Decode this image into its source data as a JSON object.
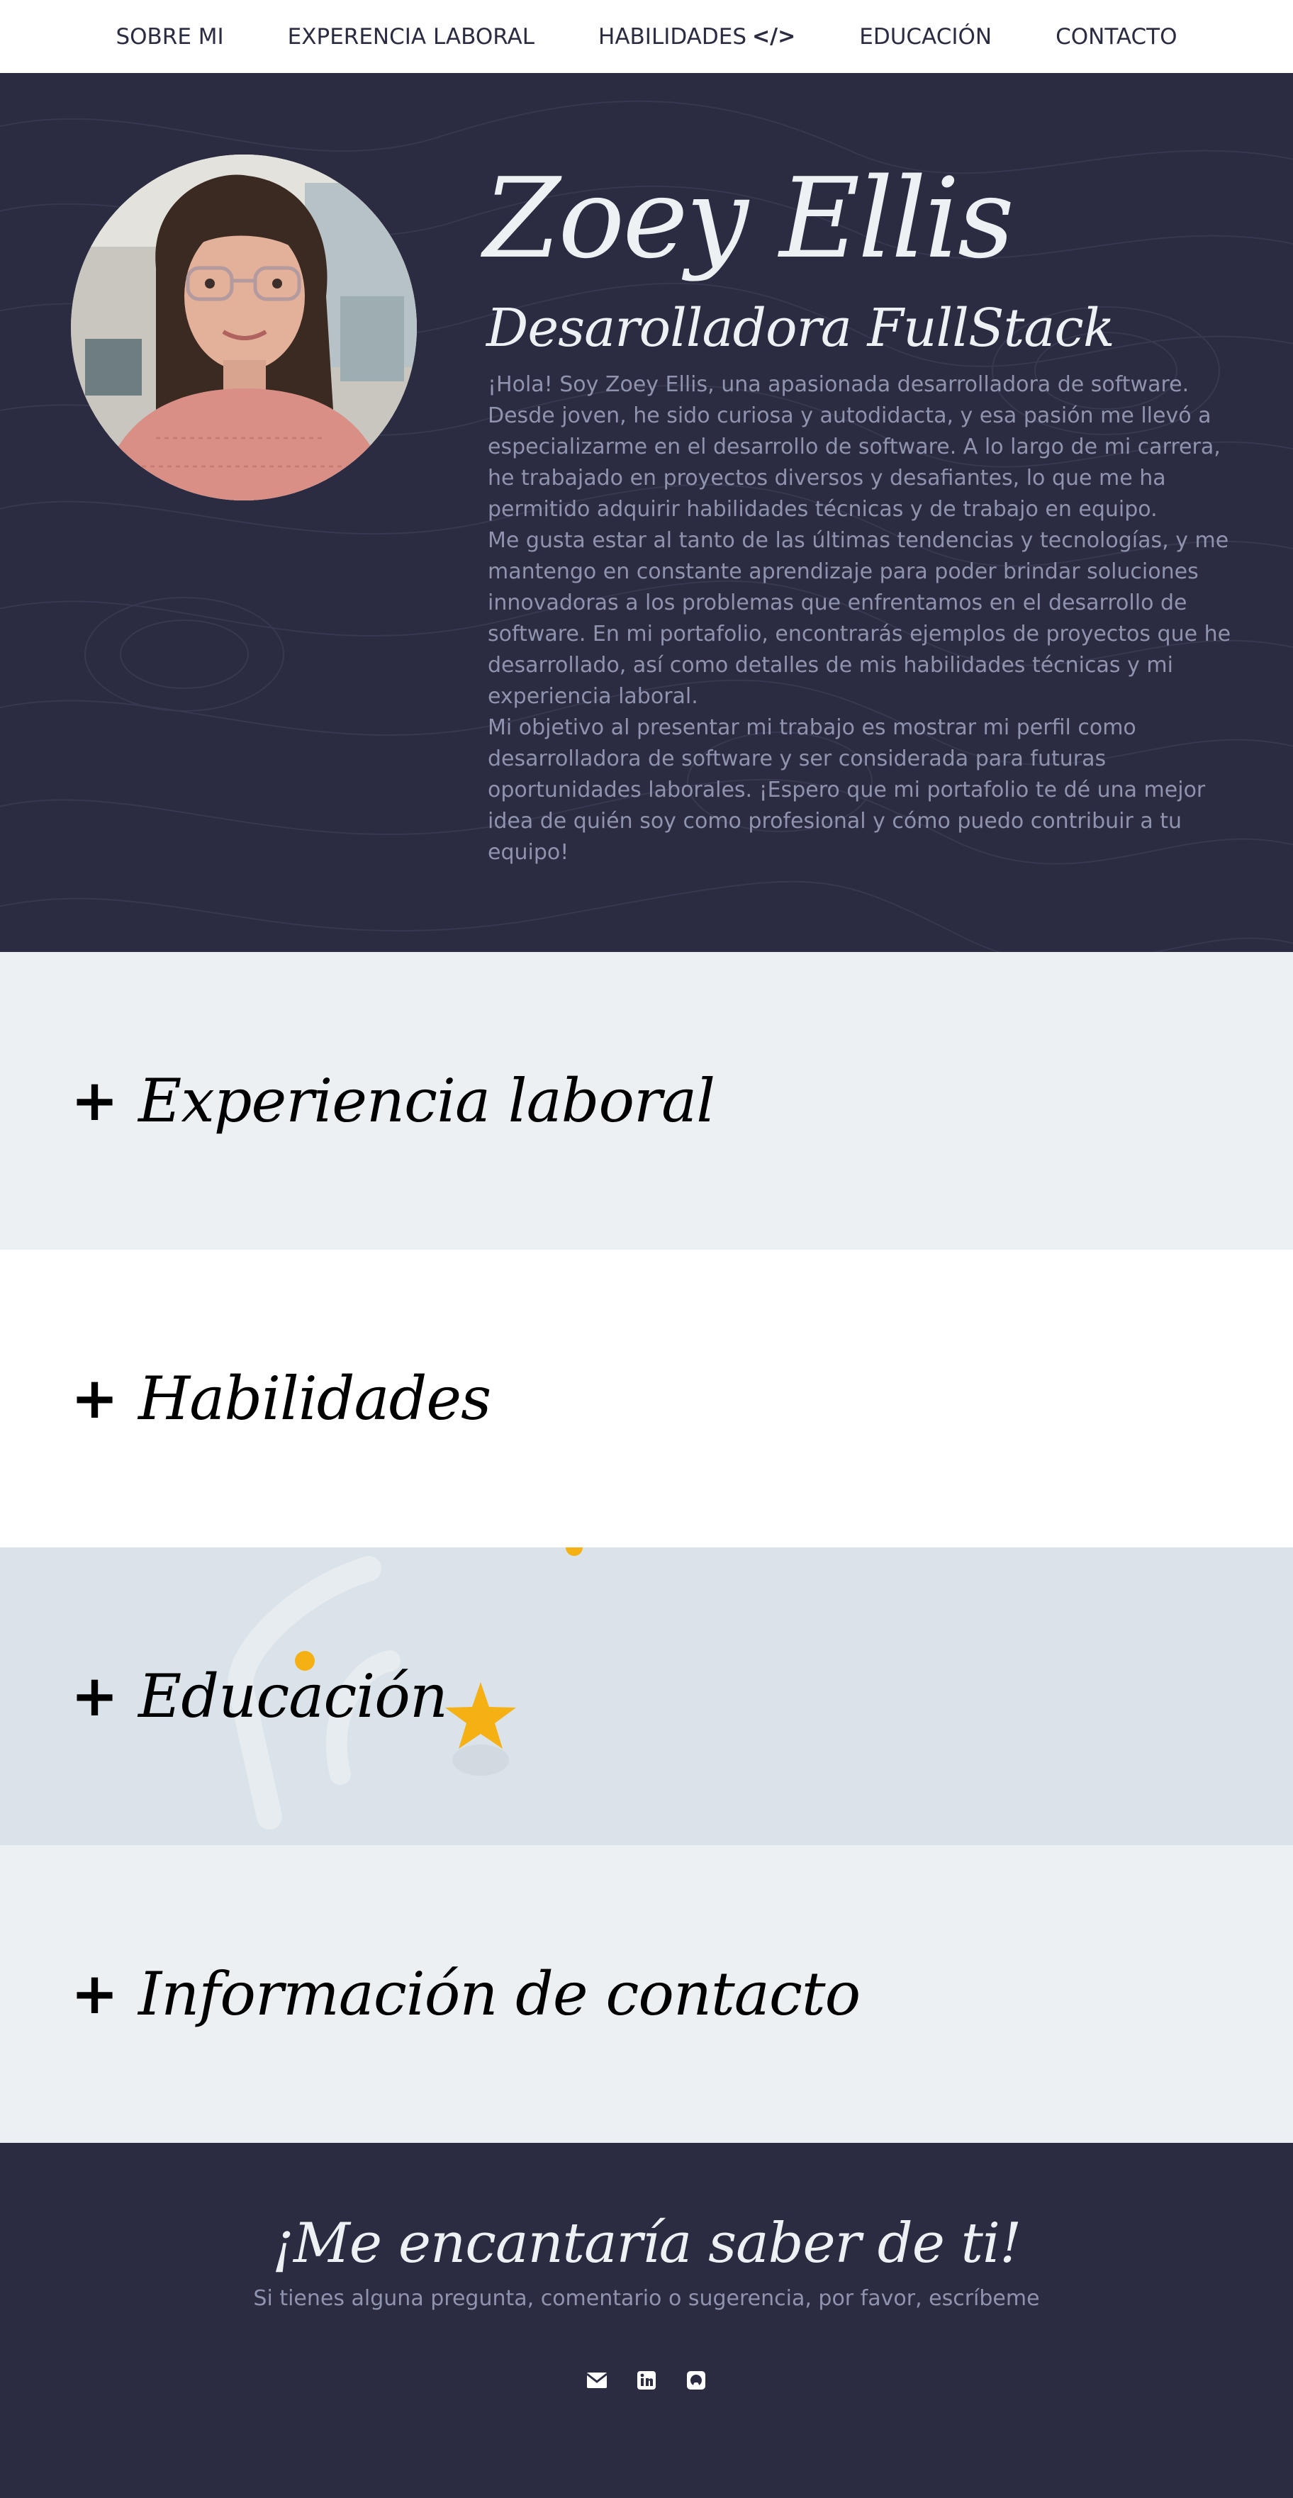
{
  "nav": {
    "items": [
      {
        "label": "SOBRE MI"
      },
      {
        "label": "EXPERENCIA LABORAL"
      },
      {
        "label": "HABILIDADES",
        "icon": "code-icon",
        "icon_glyph": "</>"
      },
      {
        "label": "EDUCACIÓN"
      },
      {
        "label": "CONTACTO"
      }
    ]
  },
  "hero": {
    "name": "Zoey Ellis",
    "role": "Desarolladora FullStack",
    "bio": [
      "¡Hola! Soy Zoey Ellis, una apasionada desarrolladora de software. Desde joven, he sido curiosa y autodidacta, y esa pasión me llevó a especializarme en el desarrollo de software. A lo largo de mi carrera, he trabajado en proyectos diversos y desafiantes, lo que me ha permitido adquirir habilidades técnicas y de trabajo en equipo.",
      "Me gusta estar al tanto de las últimas tendencias y tecnologías, y me mantengo en constante aprendizaje para poder brindar soluciones innovadoras a los problemas que enfrentamos en el desarrollo de software. En mi portafolio, encontrarás ejemplos de proyectos que he desarrollado, así como detalles de mis habilidades técnicas y mi experiencia laboral.",
      "Mi objetivo al presentar mi trabajo es mostrar mi perfil como desarrolladora de software y ser considerada para futuras oportunidades laborales. ¡Espero que mi portafolio te dé una mejor idea de quién soy como profesional y cómo puedo contribuir a tu equipo!"
    ]
  },
  "sections": [
    {
      "toggle": "+",
      "title": "Experiencia laboral"
    },
    {
      "toggle": "+",
      "title": "Habilidades"
    },
    {
      "toggle": "+",
      "title": "Educación"
    },
    {
      "toggle": "+",
      "title": "Información de contacto"
    }
  ],
  "footer": {
    "title": "¡Me encantaría saber de ti!",
    "subtitle": "Si tienes alguna pregunta, comentario o sugerencia, por favor, escríbeme",
    "socials": [
      {
        "icon": "envelope-icon"
      },
      {
        "icon": "linkedin-icon"
      },
      {
        "icon": "github-icon"
      }
    ]
  },
  "colors": {
    "navy": "#2b2c42",
    "light_text": "#edf1f3",
    "muted_text": "#8f93ad",
    "section_light": "#ecf0f3",
    "section_blue": "#dae3e9",
    "star": "#f5b014"
  }
}
